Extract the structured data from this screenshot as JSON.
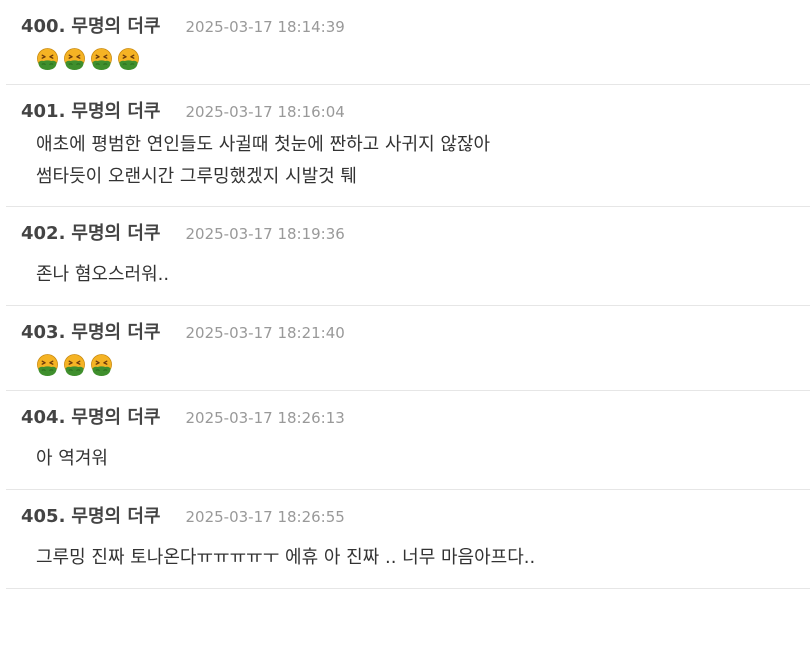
{
  "comments": [
    {
      "number": "400.",
      "author": "무명의 더쿠",
      "time": "2025-03-17 18:14:39",
      "lines": [],
      "emoji": "nauseated-face-icon",
      "emoji_count": 4
    },
    {
      "number": "401.",
      "author": "무명의 더쿠",
      "time": "2025-03-17 18:16:04",
      "lines": [
        "애초에 평범한 연인들도 사귈때 첫눈에 짠하고 사귀지 않잖아",
        "썸타듯이 오랜시간 그루밍했겠지 시발것 퉤"
      ]
    },
    {
      "number": "402.",
      "author": "무명의 더쿠",
      "time": "2025-03-17 18:19:36",
      "lines": [
        "존나 혐오스러워.."
      ]
    },
    {
      "number": "403.",
      "author": "무명의 더쿠",
      "time": "2025-03-17 18:21:40",
      "lines": [],
      "emoji": "nauseated-face-icon",
      "emoji_count": 3
    },
    {
      "number": "404.",
      "author": "무명의 더쿠",
      "time": "2025-03-17 18:26:13",
      "lines": [
        "아 역겨워"
      ]
    },
    {
      "number": "405.",
      "author": "무명의 더쿠",
      "time": "2025-03-17 18:26:55",
      "lines": [
        "그루밍 진짜 토나온다ㅠㅠㅠㅠㅜ 에휴 아 진짜 .. 너무 마음아프다.."
      ]
    }
  ],
  "colors": {
    "emoji_face": "#f5b324",
    "emoji_mouth": "#3f8f2d",
    "emoji_eyes": "#6b3a0c"
  }
}
